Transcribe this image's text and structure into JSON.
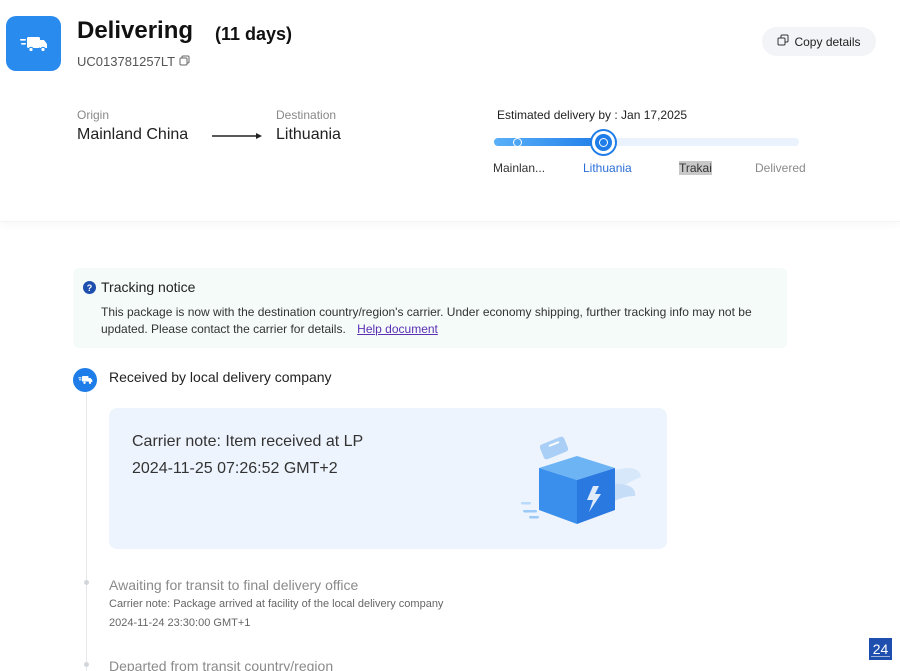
{
  "header": {
    "status": "Delivering",
    "days": "(11 days)",
    "tracking_number": "UC013781257LT",
    "copy_button": "Copy details",
    "icons": {
      "status": "truck-icon",
      "copy": "copy-icon"
    }
  },
  "route": {
    "origin_label": "Origin",
    "origin_value": "Mainland China",
    "destination_label": "Destination",
    "destination_value": "Lithuania"
  },
  "progress": {
    "estimated": "Estimated delivery by : Jan 17,2025",
    "fill_fraction": 0.36,
    "stages": [
      {
        "label": "Mainlan...",
        "state": "done"
      },
      {
        "label": "Lithuania",
        "state": "current"
      },
      {
        "label": "Trakai",
        "state": "highlighted"
      },
      {
        "label": "Delivered",
        "state": "pending"
      }
    ],
    "colors": {
      "accent": "#1e7de8",
      "current_text": "#2a6fd6",
      "pending_text": "#8a8a8a"
    }
  },
  "notice": {
    "title": "Tracking notice",
    "text": "This package is now with the destination country/region's carrier. Under economy shipping, further tracking info may not be updated. Please contact the carrier for details.",
    "link": "Help document",
    "icon": "question-icon"
  },
  "events": {
    "current": {
      "title": "Received by local delivery company",
      "note": "Carrier note: Item received at LP",
      "time": "2024-11-25 07:26:52 GMT+2",
      "icon": "truck-icon",
      "illustration": "parcel-box-illustration"
    },
    "history": [
      {
        "title": "Awaiting for transit to final delivery office",
        "note": "Carrier note: Package arrived at facility of the local delivery company",
        "time": "2024-11-24 23:30:00 GMT+1"
      },
      {
        "title": "Departed from transit country/region"
      }
    ]
  },
  "page_badge": "24"
}
